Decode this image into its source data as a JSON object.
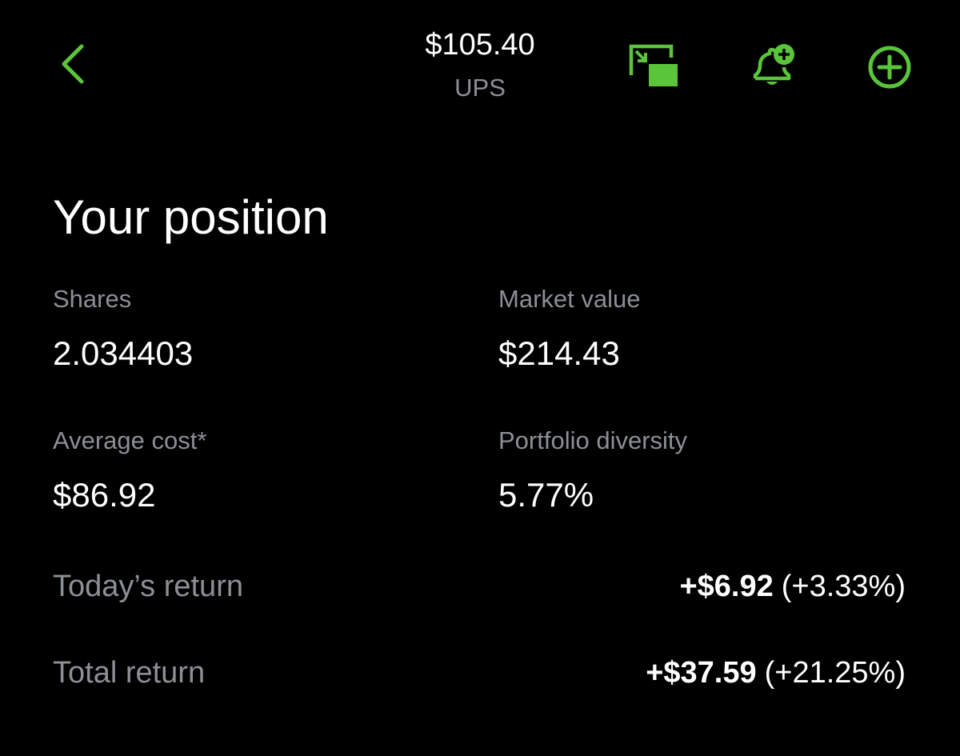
{
  "header": {
    "price": "$105.40",
    "symbol": "UPS",
    "accent_color": "#5ac53b",
    "icons": [
      "back-chevron-icon",
      "picture-in-picture-icon",
      "add-alert-bell-icon",
      "add-circle-icon"
    ]
  },
  "position": {
    "title": "Your position",
    "shares_label": "Shares",
    "shares_value": "2.034403",
    "market_value_label": "Market value",
    "market_value": "$214.43",
    "average_cost_label": "Average cost*",
    "average_cost_value": "$86.92",
    "portfolio_diversity_label": "Portfolio diversity",
    "portfolio_diversity_value": "5.77%",
    "todays_return_label": "Today’s return",
    "todays_return_amount": "+$6.92",
    "todays_return_percent": "(+3.33%)",
    "total_return_label": "Total return",
    "total_return_amount": "+$37.59",
    "total_return_percent": "(+21.25%)"
  }
}
